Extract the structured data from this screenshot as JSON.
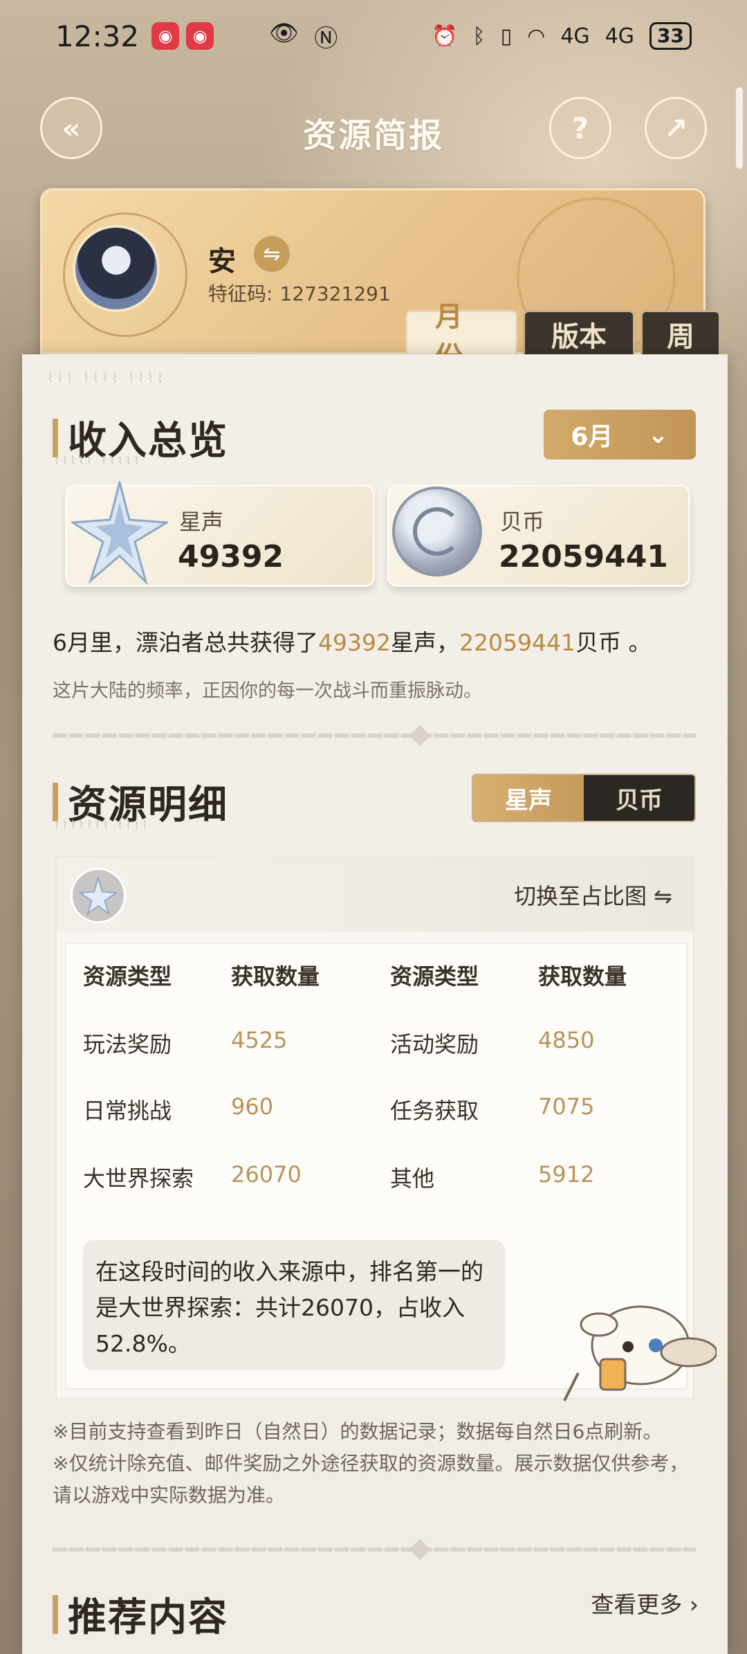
{
  "status": {
    "time": "12:32",
    "battery": "33",
    "signal": "4G"
  },
  "nav": {
    "title": "资源简报",
    "back_icon": "back-icon",
    "help_label": "?",
    "share_icon": "share-icon"
  },
  "profile": {
    "name": "安",
    "uid_label": "特征码:",
    "uid": "127321291"
  },
  "tabs": [
    {
      "label": "月份",
      "active": true
    },
    {
      "label": "版本",
      "active": false
    },
    {
      "label": "周",
      "active": false
    }
  ],
  "overview": {
    "title": "收入总览",
    "month": "6月",
    "star": {
      "label": "星声",
      "value": "49392"
    },
    "coin": {
      "label": "贝币",
      "value": "22059441"
    },
    "summary_pre": "6月里，漂泊者总共获得了",
    "summary_star": "49392",
    "summary_mid": "星声，",
    "summary_coin": "22059441",
    "summary_post": "贝币 。",
    "subtitle": "这片大陆的频率，正因你的每一次战斗而重振脉动。"
  },
  "detail": {
    "title": "资源明细",
    "toggle_on": "星声",
    "toggle_off": "贝币",
    "switch_label": "切换至占比图 ⇋",
    "headers": [
      "资源类型",
      "获取数量",
      "资源类型",
      "获取数量"
    ],
    "rows": [
      [
        "玩法奖励",
        "4525",
        "活动奖励",
        "4850"
      ],
      [
        "日常挑战",
        "960",
        "任务获取",
        "7075"
      ],
      [
        "大世界探索",
        "26070",
        "其他",
        "5912"
      ]
    ],
    "note": "在这段时间的收入来源中，排名第一的是大世界探索：共计26070，占收入52.8%。"
  },
  "footnotes": [
    "※目前支持查看到昨日（自然日）的数据记录；数据每自然日6点刷新。",
    "※仅统计除充值、邮件奖励之外途径获取的资源数量。展示数据仅供参考，请以游戏中实际数据为准。"
  ],
  "recommend": {
    "title": "推荐内容",
    "more": "查看更多 ›"
  },
  "colors": {
    "accent": "#c9a05f",
    "highlight": "#b88a43",
    "dark": "#2b2824"
  }
}
